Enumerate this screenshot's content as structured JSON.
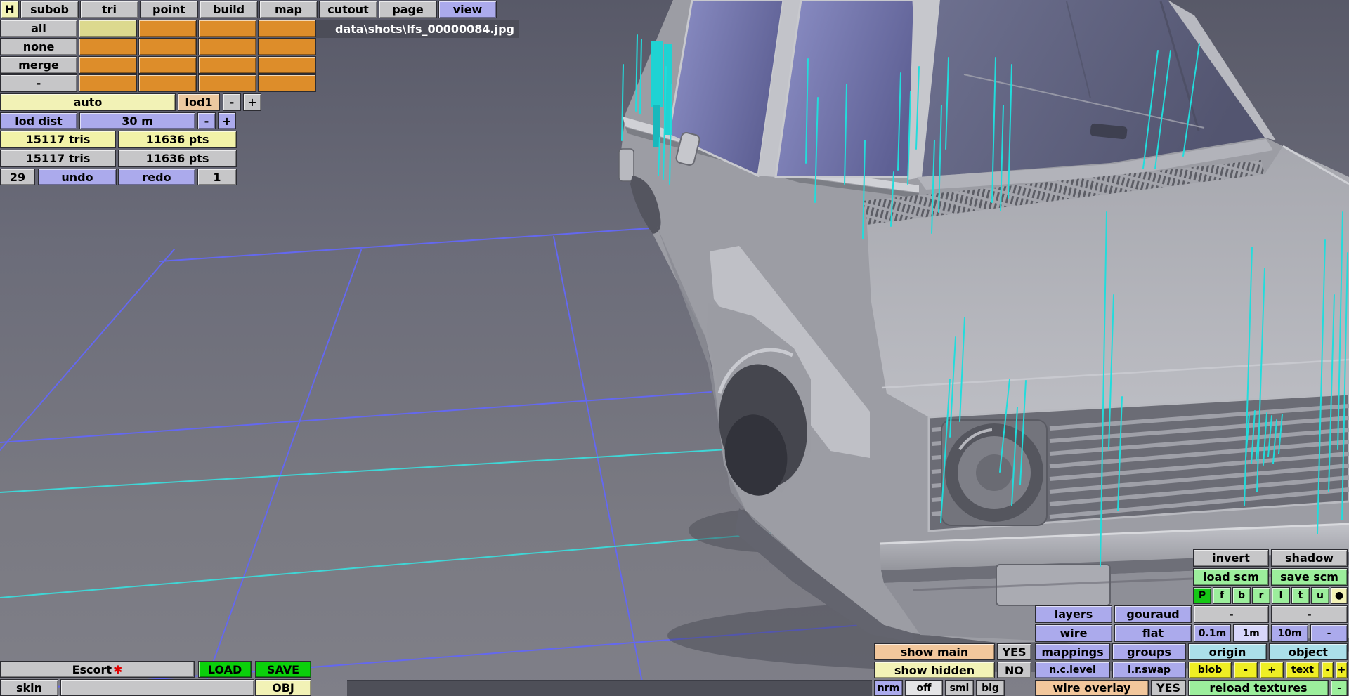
{
  "viewport": {
    "filename": "data\\shots\\lfs_00000084.jpg",
    "model": "Ford Escort mk2 3D mesh, front-left view, gray shaded with cyan selection markers",
    "accent_colors": {
      "grid_blue": "#6468f0",
      "grid_cyan": "#3fd6d6",
      "selection_cyan": "#22dcdc"
    }
  },
  "menu": {
    "items": [
      "H",
      "subob",
      "tri",
      "point",
      "build",
      "map",
      "cutout",
      "page",
      "view"
    ]
  },
  "subob_panel": {
    "row_labels": [
      "all",
      "none",
      "merge",
      "-"
    ]
  },
  "lod_panel": {
    "auto": "auto",
    "lod": "lod1",
    "minus": "-",
    "plus": "+",
    "dist_label": "lod dist",
    "dist_value": "30 m",
    "dist_minus": "-",
    "dist_plus": "+"
  },
  "stats": {
    "tris_current": "15117 tris",
    "pts_current": "11636 pts",
    "tris_total": "15117 tris",
    "pts_total": "11636 pts"
  },
  "history": {
    "undo_steps": "29",
    "undo": "undo",
    "redo": "redo",
    "redo_steps": "1"
  },
  "file_bar": {
    "name": "Escort",
    "modified": "✱",
    "load": "LOAD",
    "save": "SAVE",
    "skin": "skin",
    "skin_value": "",
    "obj": "OBJ"
  },
  "right_panel": {
    "invert": "invert",
    "shadow": "shadow",
    "load_scm": "load scm",
    "save_scm": "save scm",
    "view_keys": [
      "P",
      "f",
      "b",
      "r",
      "l",
      "t",
      "u",
      "●"
    ],
    "layers": "layers",
    "gouraud": "gouraud",
    "dash1": "-",
    "dash2": "-",
    "wire": "wire",
    "flat": "flat",
    "m01": "0.1m",
    "m1": "1m",
    "m10": "10m",
    "mdash": "-",
    "show_main": "show main",
    "show_main_val": "YES",
    "mappings": "mappings",
    "groups": "groups",
    "origin": "origin",
    "object": "object",
    "show_hidden": "show hidden",
    "show_hidden_val": "NO",
    "nclevel": "n.c.level",
    "lrswap": "l.r.swap",
    "blob": "blob",
    "blob_minus": "-",
    "blob_plus": "+",
    "text": "text",
    "text_minus": "-",
    "text_plus": "+",
    "nrm": "nrm",
    "off": "off",
    "sml": "sml",
    "big": "big",
    "wire_overlay": "wire overlay",
    "wire_overlay_val": "YES",
    "reload_textures": "reload textures",
    "reload_minus": "-"
  }
}
